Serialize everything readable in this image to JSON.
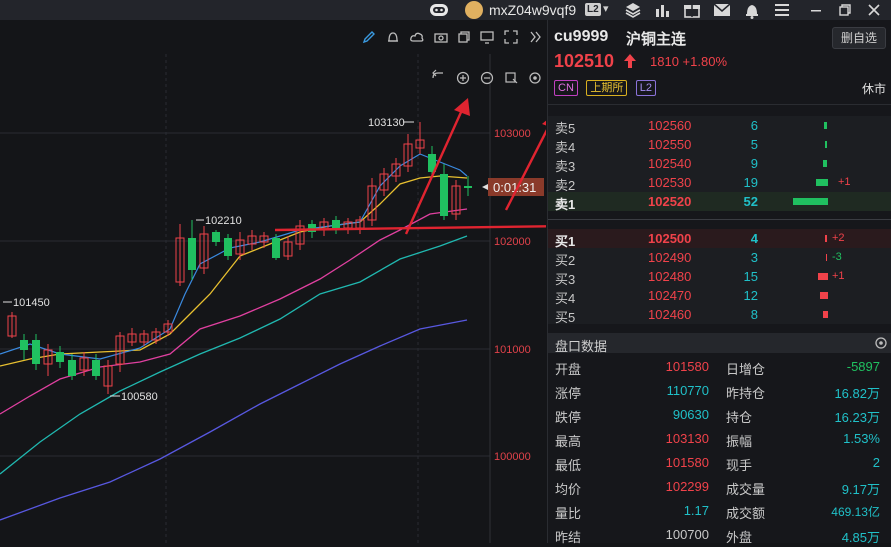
{
  "titlebar": {
    "username": "mxZ04w9vqf9",
    "level_badge": "L2"
  },
  "chart": {
    "price_axis": [
      "103000",
      "102000",
      "101000",
      "100000"
    ],
    "annotations": {
      "high": "103130",
      "mid_high": "102210",
      "left_high": "101450",
      "low": "100580"
    },
    "countdown": "0:01:31"
  },
  "quote": {
    "symbol": "cu9999",
    "name": "沪铜主连",
    "delete_button": "删自选",
    "price": "102510",
    "change": "1810",
    "change_pct": "+1.80%",
    "tags": [
      "CN",
      "上期所",
      "L2"
    ],
    "status": "休市"
  },
  "order_book": {
    "asks": [
      {
        "label": "卖5",
        "price": "102560",
        "volume": "6",
        "delta": ""
      },
      {
        "label": "卖4",
        "price": "102550",
        "volume": "5",
        "delta": ""
      },
      {
        "label": "卖3",
        "price": "102540",
        "volume": "9",
        "delta": ""
      },
      {
        "label": "卖2",
        "price": "102530",
        "volume": "19",
        "delta": "+1"
      },
      {
        "label": "卖1",
        "price": "102520",
        "volume": "52",
        "delta": ""
      }
    ],
    "bids": [
      {
        "label": "买1",
        "price": "102500",
        "volume": "4",
        "delta": "+2"
      },
      {
        "label": "买2",
        "price": "102490",
        "volume": "3",
        "delta": "-3"
      },
      {
        "label": "买3",
        "price": "102480",
        "volume": "15",
        "delta": "+1"
      },
      {
        "label": "买4",
        "price": "102470",
        "volume": "12",
        "delta": ""
      },
      {
        "label": "买5",
        "price": "102460",
        "volume": "8",
        "delta": ""
      }
    ]
  },
  "market_data": {
    "title": "盘口数据",
    "rows": [
      {
        "k1": "开盘",
        "v1": "101580",
        "k2": "日增仓",
        "v2": "-5897"
      },
      {
        "k1": "涨停",
        "v1": "110770",
        "k2": "昨持仓",
        "v2": "16.82万"
      },
      {
        "k1": "跌停",
        "v1": "90630",
        "k2": "持仓",
        "v2": "16.23万"
      },
      {
        "k1": "最高",
        "v1": "103130",
        "k2": "振幅",
        "v2": "1.53%"
      },
      {
        "k1": "最低",
        "v1": "101580",
        "k2": "现手",
        "v2": "2"
      },
      {
        "k1": "均价",
        "v1": "102299",
        "k2": "成交量",
        "v2": "9.17万"
      },
      {
        "k1": "量比",
        "v1": "1.17",
        "k2": "成交额",
        "v2": "469.13亿"
      },
      {
        "k1": "昨结",
        "v1": "100700",
        "k2": "外盘",
        "v2": "4.85万"
      }
    ]
  },
  "colors": {
    "up": "#f0424a",
    "down": "#20c060",
    "cyan": "#20c0c8",
    "bg": "#141518"
  }
}
